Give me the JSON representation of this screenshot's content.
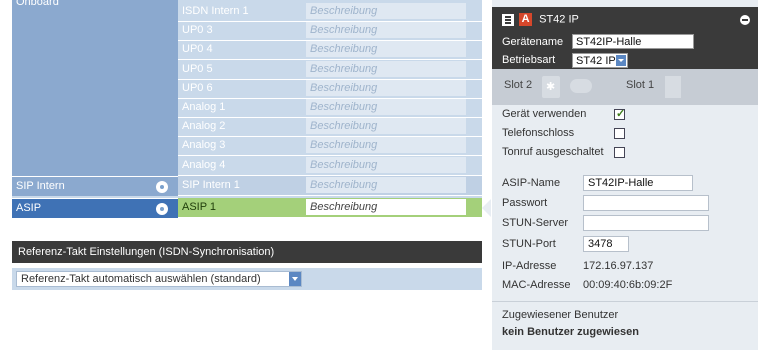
{
  "left": {
    "cat_top": "Onboard",
    "ports": [
      {
        "name": "ISDN Intern 1",
        "desc": "Beschreibung"
      },
      {
        "name": "UP0 3",
        "desc": "Beschreibung"
      },
      {
        "name": "UP0 4",
        "desc": "Beschreibung"
      },
      {
        "name": "UP0 5",
        "desc": "Beschreibung"
      },
      {
        "name": "UP0 6",
        "desc": "Beschreibung"
      },
      {
        "name": "Analog 1",
        "desc": "Beschreibung"
      },
      {
        "name": "Analog 2",
        "desc": "Beschreibung"
      },
      {
        "name": "Analog 3",
        "desc": "Beschreibung"
      },
      {
        "name": "Analog 4",
        "desc": "Beschreibung"
      }
    ],
    "sip_intern": {
      "cat": "SIP Intern",
      "name": "SIP Intern 1",
      "desc": "Beschreibung"
    },
    "asip": {
      "cat": "ASIP",
      "name": "ASIP 1",
      "desc": "Beschreibung"
    },
    "ref_header": "Referenz-Takt Einstellungen (ISDN-Synchronisation)",
    "ref_select_value": "Referenz-Takt automatisch auswählen (standard)"
  },
  "device": {
    "title": "ST42 IP",
    "name_label": "Gerätename",
    "name_value": "ST42IP-Halle",
    "mode_label": "Betriebsart",
    "mode_value": "ST42 IP",
    "slot2_label": "Slot 2",
    "slot1_label": "Slot 1",
    "use_device_label": "Gerät verwenden",
    "use_device_checked": true,
    "lock_label": "Telefonschloss",
    "lock_checked": false,
    "ring_off_label": "Tonruf ausgeschaltet",
    "ring_off_checked": false,
    "asip_name_label": "ASIP-Name",
    "asip_name_value": "ST42IP-Halle",
    "password_label": "Passwort",
    "password_value": "",
    "stun_server_label": "STUN-Server",
    "stun_server_value": "",
    "stun_port_label": "STUN-Port",
    "stun_port_value": "3478",
    "ip_label": "IP-Adresse",
    "ip_value": "172.16.97.137",
    "mac_label": "MAC-Adresse",
    "mac_value": "00:09:40:6b:09:2F",
    "assigned_user_label": "Zugewiesener Benutzer",
    "assigned_user_value": "kein Benutzer zugewiesen"
  },
  "colors": {
    "category": "#8ba9cf",
    "category_active": "#3f72b5",
    "selected_row": "#a4d07a",
    "header_dark": "#3a3a3a"
  }
}
